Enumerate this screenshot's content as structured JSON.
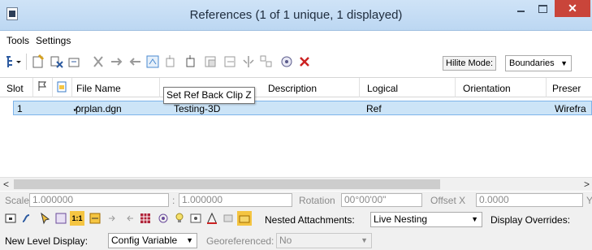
{
  "window": {
    "title": "References (1 of 1 unique, 1 displayed)",
    "close": "✕"
  },
  "menu": {
    "tools": "Tools",
    "settings": "Settings"
  },
  "toolbar": {
    "hilite_mode": "Hilite Mode:",
    "boundaries": "Boundaries"
  },
  "tooltip": "Set Ref Back Clip Z",
  "columns": [
    "Slot",
    "File Name",
    "Description",
    "Logical",
    "Orientation",
    "Preser"
  ],
  "rows": [
    {
      "slot": "1",
      "check": "✓",
      "file": "prplan.dgn",
      "description": "Testing-3D",
      "logical": "Ref",
      "orientation": "",
      "presentation": "Wirefra"
    }
  ],
  "settings": {
    "scale_label": "Scale",
    "scale_value": "1.000000",
    "scale_colon": ":",
    "scale_value2": "1.000000",
    "rotation_label": "Rotation",
    "rotation_value": "00°00'00\"",
    "offset_label": "Offset X",
    "offset_value": "0.0000",
    "offset_y_label": "Y",
    "nested_label": "Nested Attachments:",
    "nested_value": "Live Nesting",
    "display_overrides_label": "Display Overrides:",
    "new_level_label": "New Level Display:",
    "new_level_value": "Config Variable",
    "georef_label": "Georeferenced:",
    "georef_value": "No"
  }
}
